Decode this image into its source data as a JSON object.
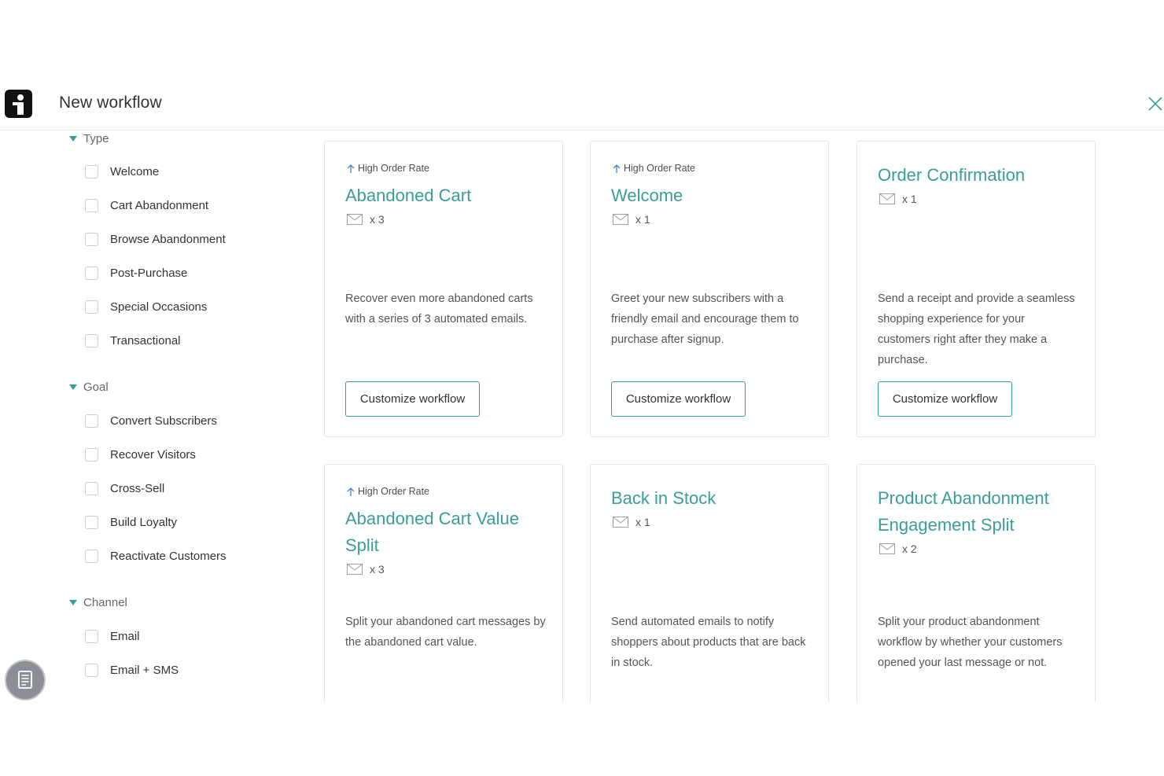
{
  "header": {
    "title": "New workflow"
  },
  "sidebar": {
    "groups": [
      {
        "label": "Type",
        "options": [
          "Welcome",
          "Cart Abandonment",
          "Browse Abandonment",
          "Post-Purchase",
          "Special Occasions",
          "Transactional"
        ]
      },
      {
        "label": "Goal",
        "options": [
          "Convert Subscribers",
          "Recover Visitors",
          "Cross-Sell",
          "Build Loyalty",
          "Reactivate Customers"
        ]
      },
      {
        "label": "Channel",
        "options": [
          "Email",
          "Email + SMS"
        ]
      }
    ]
  },
  "cards": [
    {
      "badge": "High Order Rate",
      "title": "Abandoned Cart",
      "count": "x 3",
      "description": "Recover even more abandoned carts with a series of 3 automated emails.",
      "button": "Customize workflow"
    },
    {
      "badge": "High Order Rate",
      "title": "Welcome",
      "count": "x 1",
      "description": "Greet your new subscribers with a friendly email and encourage them to purchase after signup.",
      "button": "Customize workflow"
    },
    {
      "badge": "",
      "title": "Order Confirmation",
      "count": "x 1",
      "description": "Send a receipt and provide a seamless shopping experience for your customers right after they make a purchase.",
      "button": "Customize workflow"
    },
    {
      "badge": "High Order Rate",
      "title": "Abandoned Cart Value Split",
      "count": "x 3",
      "description": "Split your abandoned cart messages by the abandoned cart value.",
      "button": ""
    },
    {
      "badge": "",
      "title": "Back in Stock",
      "count": "x 1",
      "description": "Send automated emails to notify shoppers about products that are back in stock.",
      "button": ""
    },
    {
      "badge": "",
      "title": "Product Abandonment Engagement Split",
      "count": "x 2",
      "description": "Split your product abandonment workflow by whether your customers opened your last message or not.",
      "button": ""
    }
  ],
  "colors": {
    "accent": "#3a9e97",
    "border": "#e3e6e8",
    "text": "#333333"
  },
  "icons": {
    "logo": "brand-logo-icon",
    "close": "close-icon",
    "mail": "mail-icon",
    "arrow": "arrow-up-icon",
    "caret": "caret-down-icon",
    "fab": "notes-icon"
  }
}
